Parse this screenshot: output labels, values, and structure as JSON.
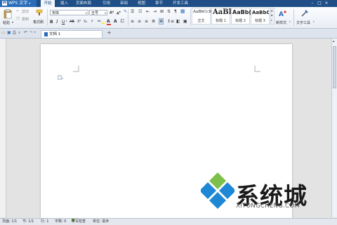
{
  "app": {
    "name": "WPS 文字",
    "logo_letter": "W"
  },
  "menu": {
    "tabs": [
      "开始",
      "插入",
      "页面布局",
      "引用",
      "审阅",
      "视图",
      "章节",
      "开发工具"
    ],
    "active": "开始"
  },
  "ribbon": {
    "paste": "粘贴",
    "cut": "剪切",
    "copy": "复制",
    "format_painter": "格式刷",
    "font_name": "宋体",
    "font_size": "五号",
    "styles": [
      {
        "sample": "AaBbCcDd",
        "label": "正文"
      },
      {
        "sample": "AaBl",
        "label": "标题 1"
      },
      {
        "sample": "AaBb(",
        "label": "标题 2"
      },
      {
        "sample": "AaBbC",
        "label": "标题 3"
      }
    ],
    "new_style": "新样式",
    "text_tools": "文字工具"
  },
  "tabs": {
    "doc_title": "文档 1",
    "new_tab": "+"
  },
  "status": {
    "page": "页面: 1/1",
    "section": "节: 1/1",
    "row": "行: 1",
    "words": "字数: 0",
    "spell": "拼写检查",
    "unit": "单位: 毫米"
  },
  "watermark": {
    "brand": "系统城",
    "url": "XITONGCHENG.COM"
  },
  "colors": {
    "title_bar": "#1f4f86",
    "accent": "#2b6cb8",
    "logo_blue": "#1e88d6",
    "logo_green": "#7cc04b"
  }
}
